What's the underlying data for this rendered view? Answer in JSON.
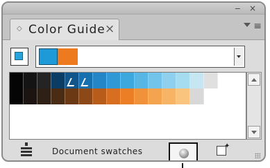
{
  "panel": {
    "title_tab": "Color Guide",
    "tab_close_glyph": "×",
    "minimize_glyph": "−",
    "close_glyph": "×",
    "menu_glyph": "≡"
  },
  "active_color": {
    "color": "#28a4dc"
  },
  "harmony": {
    "colors": [
      "#1e9ad8",
      "#ee7a1f"
    ]
  },
  "guide": {
    "rows": [
      [
        "#050505",
        "#141414",
        "#242424",
        "#0a3d66",
        "#11558a",
        "#1670b0",
        "#2486c6",
        "#3098d4",
        "#3ca8de",
        "#58b6e4",
        "#73c4ea",
        "#8fd0ee",
        "#a6dcf0",
        "#c6e6f2",
        "#e0e0e0",
        "#ffffff",
        "#ffffff"
      ],
      [
        "#050505",
        "#1c1410",
        "#2e2014",
        "#4a2c14",
        "#6b3a14",
        "#8c4816",
        "#b85c1a",
        "#d86e20",
        "#ec7e26",
        "#f0923a",
        "#f4a44e",
        "#f6b464",
        "#f8c47e",
        "#d8d8d8",
        "#ffffff",
        "#ffffff",
        "#ffffff"
      ]
    ],
    "selected": [
      4,
      5
    ]
  },
  "footer": {
    "label": "Document swatches",
    "library_icon": "swatch-library-icon",
    "save_icon": "save-group-icon",
    "edit_icon": "edit-colors-icon"
  }
}
